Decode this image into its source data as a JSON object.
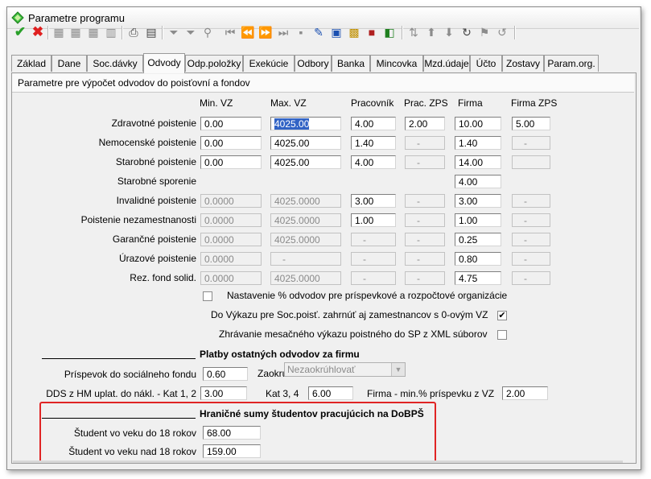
{
  "window": {
    "title": "Parametre programu"
  },
  "toolbar": {
    "icons": [
      "confirm-icon",
      "cancel-icon",
      "first-record-icon",
      "prev-record-icon",
      "next-record-icon",
      "last-record-icon",
      "print-icon",
      "preview-icon",
      "filter-icon",
      "clear-filter-icon",
      "find-icon",
      "go-first-icon",
      "go-prev-page-icon",
      "go-next-page-icon",
      "go-last-page-icon",
      "insert-icon",
      "tools-icon",
      "calculator-icon",
      "export-icon",
      "colors-icon",
      "sort-icon",
      "up-icon",
      "down-icon",
      "refresh-icon",
      "bookmark-icon",
      "undo-icon"
    ]
  },
  "tabs": [
    "Základ",
    "Dane",
    "Soc.dávky",
    "Odvody",
    "Odp.položky",
    "Exekúcie",
    "Odbory",
    "Banka",
    "Mincovka",
    "Mzd.údaje",
    "Účto",
    "Zostavy",
    "Param.org."
  ],
  "active_tab": "Odvody",
  "section_title": "Parametre pre výpočet odvodov do poisťovní a fondov",
  "columns": [
    "Min. VZ",
    "Max. VZ",
    "Pracovník",
    "Prac. ZPS",
    "Firma",
    "Firma ZPS"
  ],
  "rows": [
    {
      "label": "Zdravotné poistenie",
      "min_vz": "0.00",
      "max_vz": "4025.00",
      "pracovnik": "4.00",
      "prac_zps": "2.00",
      "firma": "10.00",
      "firma_zps": "5.00"
    },
    {
      "label": "Nemocenské poistenie",
      "min_vz": "0.00",
      "max_vz": "4025.00",
      "pracovnik": "1.40",
      "prac_zps": "-",
      "firma": "1.40",
      "firma_zps": "-"
    },
    {
      "label": "Starobné poistenie",
      "min_vz": "0.00",
      "max_vz": "4025.00",
      "pracovnik": "4.00",
      "prac_zps": "-",
      "firma": "14.00",
      "firma_zps": ""
    },
    {
      "label": "Starobné sporenie",
      "firma": "4.00"
    },
    {
      "label": "Invalidné poistenie",
      "min_vz": "0.0000",
      "max_vz": "4025.0000",
      "pracovnik": "3.00",
      "prac_zps": "-",
      "firma": "3.00",
      "firma_zps": "-"
    },
    {
      "label": "Poistenie  nezamestnanosti",
      "min_vz": "0.0000",
      "max_vz": "4025.0000",
      "pracovnik": "1.00",
      "prac_zps": "-",
      "firma": "1.00",
      "firma_zps": "-"
    },
    {
      "label": "Garančné poistenie",
      "min_vz": "0.0000",
      "max_vz": "4025.0000",
      "pracovnik": "-",
      "prac_zps": "-",
      "firma": "0.25",
      "firma_zps": "-"
    },
    {
      "label": "Úrazové poistenie",
      "min_vz": "0.0000",
      "max_vz": "-",
      "pracovnik": "-",
      "prac_zps": "-",
      "firma": "0.80",
      "firma_zps": "-"
    },
    {
      "label": "Rez. fond solid.",
      "min_vz": "0.0000",
      "max_vz": "4025.0000",
      "pracovnik": "-",
      "prac_zps": "-",
      "firma": "4.75",
      "firma_zps": "-"
    }
  ],
  "options": {
    "percent_setting_label": "Nastavenie % odvodov pre príspevkové a rozpočtové organizácie",
    "zero_vz_label": "Do Výkazu pre Soc.poisť. zahrnúť aj zamestnancov s 0-ovým VZ",
    "xml_label": "Zhrávanie mesačného výkazu poistného do SP z XML súborov"
  },
  "other": {
    "title": "Platby ostatných odvodov za firmu",
    "social_fund_label": "Príspevok do sociálneho fondu",
    "social_fund_value": "0.60",
    "rounding_label": "Zaokrúhl.",
    "rounding_value": "Nezaokrúhlovať",
    "dds_label": "DDS z HM uplat. do nákl. - Kat 1, 2",
    "dds_value": "3.00",
    "kat34_label": "Kat 3, 4",
    "kat34_value": "6.00",
    "min_pct_label": "Firma - min.% príspevku z VZ",
    "min_pct_value": "2.00"
  },
  "students": {
    "title": "Hraničné sumy študentov pracujúcich na DoBPŠ",
    "under18_label": "Študent vo veku do 18 rokov",
    "under18_value": "68.00",
    "over18_label": "Študent vo veku nad 18 rokov",
    "over18_value": "159.00"
  }
}
